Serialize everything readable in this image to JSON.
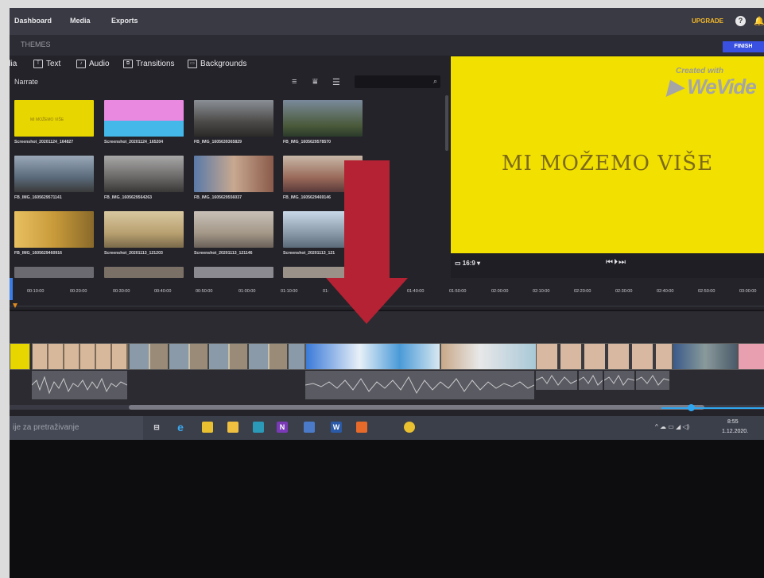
{
  "topnav": {
    "dashboard": "Dashboard",
    "media": "Media",
    "exports": "Exports",
    "upgrade": "UPGRADE"
  },
  "themes": {
    "label": "THEMES",
    "finish": "FINISH"
  },
  "media_tabs": [
    {
      "label": "dia",
      "icon": "media-icon"
    },
    {
      "label": "Text",
      "icon": "text-icon"
    },
    {
      "label": "Audio",
      "icon": "audio-icon"
    },
    {
      "label": "Transitions",
      "icon": "transitions-icon"
    },
    {
      "label": "Backgrounds",
      "icon": "backgrounds-icon"
    }
  ],
  "narrate": "Narrate",
  "media_items": [
    {
      "label": "Screenshot_20201124_164827",
      "color": "#e8d600"
    },
    {
      "label": "Screenshot_20201124_165204",
      "color": "#e88ae0"
    },
    {
      "label": "FB_IMG_1605639365829",
      "color": "#6a6a66"
    },
    {
      "label": "FB_IMG_1605629578570",
      "color": "#5a6a4a"
    },
    {
      "label": "FB_IMG_1605629571141",
      "color": "#6c7884"
    },
    {
      "label": "FB_IMG_1605629564263",
      "color": "#7c7a78"
    },
    {
      "label": "FB_IMG_1605629556037",
      "color": "#8a6a5a"
    },
    {
      "label": "FB_IMG_1605629469146",
      "color": "#9a7a6a"
    },
    {
      "label": "FB_IMG_1605629460916",
      "color": "#c89a3a"
    },
    {
      "label": "Screenshot_20201113_121203",
      "color": "#b8a070"
    },
    {
      "label": "Screenshot_20201113_121146",
      "color": "#a49888"
    },
    {
      "label": "Screenshot_20201113_121",
      "color": "#8a9aa8"
    }
  ],
  "preview": {
    "text": "MI MOŽEMO VIŠE",
    "watermark_line1": "Created with",
    "watermark_logo": "WeVide",
    "aspect": "16:9",
    "playback": "⏮⏵⏭"
  },
  "ruler_ticks": [
    "00:10:00",
    "00:20:00",
    "00:30:00",
    "00:40:00",
    "00:50:00",
    "01:00:00",
    "01:10:00",
    "01:",
    "01:40:00",
    "01:50:00",
    "02:00:00",
    "02:10:00",
    "02:20:00",
    "02:30:00",
    "02:40:00",
    "02:50:00",
    "03:00:00"
  ],
  "taskbar": {
    "search": "ije za pretraživanje",
    "time": "8:55",
    "date": "1.12.2020."
  },
  "colors": {
    "accent_finish": "#3a50e0",
    "upgrade": "#f2b82a",
    "canvas_yellow": "#f1e000",
    "arrow_red": "#b52233"
  }
}
